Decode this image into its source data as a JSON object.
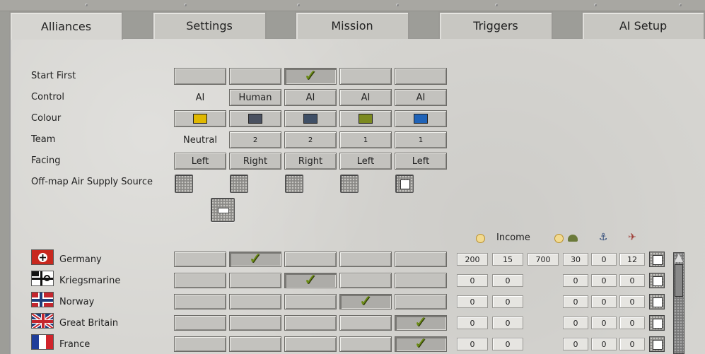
{
  "tabs": [
    {
      "label": "Alliances",
      "active": true
    },
    {
      "label": "Settings",
      "active": false
    },
    {
      "label": "Mission",
      "active": false
    },
    {
      "label": "Triggers",
      "active": false
    },
    {
      "label": "AI Setup",
      "active": false
    }
  ],
  "rows": {
    "start_first": "Start First",
    "control": "Control",
    "colour": "Colour",
    "team": "Team",
    "facing": "Facing",
    "air_supply": "Off-map Air Supply Source"
  },
  "columns": [
    {
      "start_first": false,
      "control": "AI",
      "control_button": false,
      "colour": "#e0b800",
      "team": "Neutral",
      "team_button": false,
      "facing": "Left",
      "air_supply": false
    },
    {
      "start_first": false,
      "control": "Human",
      "control_button": true,
      "colour": "#4a5160",
      "team": "2",
      "team_button": true,
      "facing": "Right",
      "air_supply": false
    },
    {
      "start_first": true,
      "control": "AI",
      "control_button": true,
      "colour": "#3f4f66",
      "team": "2",
      "team_button": true,
      "facing": "Right",
      "air_supply": false
    },
    {
      "start_first": false,
      "control": "AI",
      "control_button": true,
      "colour": "#7c8a20",
      "team": "1",
      "team_button": true,
      "facing": "Left",
      "air_supply": false
    },
    {
      "start_first": false,
      "control": "AI",
      "control_button": true,
      "colour": "#1f63b8",
      "team": "1",
      "team_button": true,
      "facing": "Left",
      "air_supply": true
    }
  ],
  "resources_header": {
    "income": "Income",
    "icons": [
      "gold-coin-icon",
      "gold-coin-icon",
      "helmet-icon",
      "anchor-icon",
      "plane-icon"
    ]
  },
  "nations": [
    {
      "name": "Germany",
      "flag": "germany-flag-icon",
      "selected": 1,
      "values": [
        "200",
        "15",
        "700",
        "30",
        "0",
        "12"
      ]
    },
    {
      "name": "Kriegsmarine",
      "flag": "kriegsmarine-flag-icon",
      "selected": 2,
      "values": [
        "0",
        "0",
        "",
        "0",
        "0",
        "0"
      ]
    },
    {
      "name": "Norway",
      "flag": "norway-flag-icon",
      "selected": 3,
      "values": [
        "0",
        "0",
        "",
        "0",
        "0",
        "0"
      ]
    },
    {
      "name": "Great Britain",
      "flag": "great-britain-flag-icon",
      "selected": 4,
      "values": [
        "0",
        "0",
        "",
        "0",
        "0",
        "0"
      ]
    },
    {
      "name": "France",
      "flag": "france-flag-icon",
      "selected": 4,
      "values": [
        "0",
        "0",
        "",
        "0",
        "0",
        "0"
      ]
    }
  ],
  "check_glyph": "✓"
}
